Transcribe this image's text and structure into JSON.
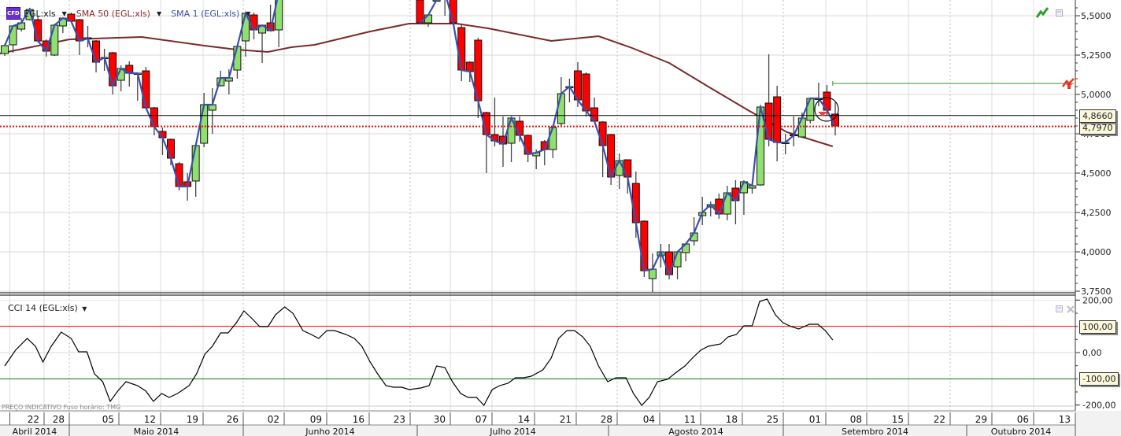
{
  "legend": {
    "symbol_badge": "CFD",
    "symbol": "EGL:xls",
    "sma50": "SMA 50 (EGL:xls)",
    "sma1": "SMA 1 (EGL:xls)"
  },
  "cci_legend": "CCI 14 (EGL:xls)",
  "footnote": "PREÇO INDICATIVO   Fuso horário: TMG",
  "colors": {
    "up": "#90e070",
    "down": "#ff0000",
    "sma50": "#7b2a2a",
    "sma1": "#3b4fae",
    "cci": "#000000",
    "cci_upper": "#ff0000",
    "cci_lower": "#1a6a1a",
    "last_price": "#000000",
    "bid": "#ff0000",
    "alert": "#2a9a2a"
  },
  "price_axis": {
    "ticks": [
      "5,5000",
      "5,2500",
      "5,0000",
      "4,7500",
      "4,5000",
      "4,2500",
      "4,0000",
      "3,7500"
    ],
    "tick_values": [
      5.5,
      5.25,
      5.0,
      4.75,
      4.5,
      4.25,
      4.0,
      3.75
    ]
  },
  "price_tags": {
    "last": "4,8660",
    "last_value": 4.866,
    "bid": "4,7970",
    "bid_value": 4.797
  },
  "alert_level": 5.07,
  "cci_axis": {
    "ticks": [
      "200,00",
      "0,00",
      "-200,00"
    ],
    "tick_values": [
      200,
      0,
      -200
    ],
    "upper": "100,00",
    "upper_value": 100,
    "lower": "-100,00",
    "lower_value": -100
  },
  "x_axis": {
    "days": [
      "22",
      "28",
      "05",
      "12",
      "19",
      "26",
      "02",
      "09",
      "16",
      "23",
      "30",
      "07",
      "14",
      "21",
      "28",
      "04",
      "11",
      "18",
      "25",
      "01",
      "08",
      "15",
      "22",
      "29",
      "06",
      "13"
    ],
    "months": [
      "Abril 2014",
      "Maio 2014",
      "Junho 2014",
      "Julho 2014",
      "Agosto 2014",
      "Setembro 2014",
      "Outubro 2014"
    ]
  },
  "chart_data": {
    "type": "candlestick",
    "ohlc_index_start": 0,
    "ohlc": [
      [
        5.26,
        5.32,
        5.245,
        5.31
      ],
      [
        5.315,
        5.44,
        5.265,
        5.435
      ],
      [
        5.415,
        5.485,
        5.4,
        5.455
      ],
      [
        5.475,
        5.55,
        5.47,
        5.54
      ],
      [
        5.475,
        5.5,
        5.33,
        5.34
      ],
      [
        5.34,
        5.35,
        5.24,
        5.275
      ],
      [
        5.25,
        5.45,
        5.245,
        5.44
      ],
      [
        5.435,
        5.49,
        5.39,
        5.485
      ],
      [
        5.51,
        5.52,
        5.46,
        5.465
      ],
      [
        5.475,
        5.48,
        5.25,
        5.34
      ],
      [
        5.36,
        5.435,
        5.3,
        5.355
      ],
      [
        5.34,
        5.345,
        5.14,
        5.205
      ],
      [
        5.235,
        5.29,
        5.15,
        5.235
      ],
      [
        5.265,
        5.27,
        5.0,
        5.055
      ],
      [
        5.09,
        5.185,
        5.02,
        5.165
      ],
      [
        5.185,
        5.21,
        5.05,
        5.135
      ],
      [
        5.135,
        5.14,
        4.96,
        5.135
      ],
      [
        5.15,
        5.175,
        4.91,
        4.915
      ],
      [
        4.915,
        4.92,
        4.74,
        4.795
      ],
      [
        4.765,
        4.79,
        4.615,
        4.725
      ],
      [
        4.715,
        4.72,
        4.55,
        4.595
      ],
      [
        4.56,
        4.57,
        4.39,
        4.415
      ],
      [
        4.445,
        4.5,
        4.325,
        4.415
      ],
      [
        4.45,
        4.68,
        4.35,
        4.675
      ],
      [
        4.69,
        5.01,
        4.665,
        4.935
      ],
      [
        4.9,
        5.04,
        4.75,
        4.935
      ],
      [
        5.055,
        5.15,
        5.05,
        5.105
      ],
      [
        5.085,
        5.16,
        5.0,
        5.105
      ],
      [
        5.155,
        5.305,
        5.1,
        5.305
      ],
      [
        5.34,
        5.515,
        5.24,
        5.515
      ],
      [
        5.505,
        5.52,
        5.35,
        5.41
      ],
      [
        5.39,
        5.44,
        5.2,
        5.44
      ],
      [
        5.455,
        5.57,
        5.4,
        5.405
      ],
      [
        5.41,
        5.7,
        5.3,
        5.65
      ],
      null,
      null,
      null,
      null,
      null,
      null,
      null,
      null,
      null,
      null,
      null,
      null,
      null,
      null,
      null,
      null,
      [
        5.6,
        5.65,
        5.455,
        5.455
      ],
      [
        5.455,
        5.505,
        5.43,
        5.505
      ],
      [
        5.6,
        5.65,
        5.6,
        5.6
      ],
      [
        5.62,
        5.7,
        5.5,
        5.65
      ],
      [
        5.65,
        5.7,
        5.44,
        5.455
      ],
      [
        5.425,
        5.44,
        5.085,
        5.155
      ],
      [
        5.205,
        5.21,
        5.08,
        5.145
      ],
      [
        5.345,
        5.36,
        4.85,
        4.96
      ],
      [
        4.885,
        4.89,
        4.5,
        4.745
      ],
      [
        4.745,
        4.98,
        4.67,
        4.705
      ],
      [
        4.735,
        4.86,
        4.54,
        4.685
      ],
      [
        4.69,
        4.86,
        4.57,
        4.85
      ],
      [
        4.83,
        4.86,
        4.7,
        4.74
      ],
      [
        4.74,
        4.745,
        4.57,
        4.62
      ],
      [
        4.61,
        4.65,
        4.525,
        4.63
      ],
      [
        4.7,
        4.71,
        4.55,
        4.65
      ],
      [
        4.65,
        4.8,
        4.595,
        4.79
      ],
      [
        4.815,
        5.11,
        4.8,
        5.005
      ],
      [
        5.045,
        5.1,
        4.95,
        5.05
      ],
      [
        5.15,
        5.205,
        4.92,
        4.965
      ],
      [
        5.13,
        5.14,
        4.86,
        4.895
      ],
      [
        4.915,
        4.98,
        4.82,
        4.83
      ],
      [
        4.825,
        4.83,
        4.475,
        4.675
      ],
      [
        4.745,
        4.75,
        4.425,
        4.475
      ],
      [
        4.485,
        4.625,
        4.4,
        4.58
      ],
      [
        4.585,
        4.585,
        4.37,
        4.475
      ],
      [
        4.435,
        4.51,
        4.09,
        4.185
      ],
      [
        4.195,
        4.2,
        3.84,
        3.88
      ],
      [
        3.83,
        3.99,
        3.74,
        3.89
      ],
      [
        3.975,
        4.05,
        3.9,
        4.0
      ],
      [
        4.0,
        4.05,
        3.825,
        3.855
      ],
      [
        3.905,
        4.0,
        3.825,
        4.0
      ],
      [
        3.995,
        4.05,
        3.94,
        4.05
      ],
      [
        4.07,
        4.22,
        4.04,
        4.12
      ],
      [
        4.23,
        4.35,
        4.17,
        4.25
      ],
      [
        4.285,
        4.32,
        4.225,
        4.3
      ],
      [
        4.335,
        4.37,
        4.21,
        4.24
      ],
      [
        4.24,
        4.42,
        4.2,
        4.375
      ],
      [
        4.405,
        4.455,
        4.175,
        4.325
      ],
      [
        4.375,
        4.455,
        4.235,
        4.445
      ],
      [
        4.405,
        4.43,
        4.37,
        4.42
      ],
      [
        4.425,
        4.935,
        4.42,
        4.92
      ],
      [
        4.945,
        5.255,
        4.67,
        4.715
      ],
      [
        4.985,
        5.055,
        4.575,
        4.695
      ],
      [
        4.695,
        4.75,
        4.62,
        4.695
      ],
      [
        4.745,
        4.86,
        4.67,
        4.74
      ],
      [
        4.73,
        4.885,
        4.725,
        4.85
      ],
      [
        4.835,
        4.98,
        4.815,
        4.975
      ],
      [
        4.975,
        5.075,
        4.925,
        4.975
      ],
      [
        5.015,
        5.06,
        4.865,
        4.9
      ],
      [
        4.875,
        4.95,
        4.74,
        4.8
      ]
    ],
    "sma50": [
      [
        -0.6,
        5.26
      ],
      [
        7.8,
        5.35
      ],
      [
        16.5,
        5.365
      ],
      [
        24,
        5.31
      ],
      [
        27.9,
        5.285
      ],
      [
        31.7,
        5.27
      ],
      [
        34.5,
        5.3
      ],
      [
        37.3,
        5.315
      ],
      [
        44,
        5.4
      ],
      [
        48.7,
        5.45
      ],
      [
        54.4,
        5.45
      ],
      [
        58.2,
        5.42
      ],
      [
        65.8,
        5.34
      ],
      [
        71.5,
        5.37
      ],
      [
        75.3,
        5.3
      ],
      [
        80,
        5.2
      ],
      [
        84.7,
        5.05
      ],
      [
        89.5,
        4.9
      ],
      [
        94.2,
        4.76
      ],
      [
        99.7,
        4.67
      ]
    ],
    "cci": [
      [
        0,
        -51
      ],
      [
        1.3,
        9
      ],
      [
        2.7,
        54
      ],
      [
        3.7,
        24
      ],
      [
        4.6,
        -36
      ],
      [
        5.6,
        24
      ],
      [
        6.8,
        78
      ],
      [
        8,
        54
      ],
      [
        8.9,
        3
      ],
      [
        9.9,
        3
      ],
      [
        10.8,
        -81
      ],
      [
        11.8,
        -111
      ],
      [
        12.7,
        -186
      ],
      [
        13.6,
        -147
      ],
      [
        14.6,
        -111
      ],
      [
        16,
        -126
      ],
      [
        17,
        -147
      ],
      [
        17.9,
        -186
      ],
      [
        18.9,
        -156
      ],
      [
        19.8,
        -171
      ],
      [
        20.8,
        -156
      ],
      [
        22.2,
        -126
      ],
      [
        23.1,
        -81
      ],
      [
        24.1,
        -6
      ],
      [
        25,
        24
      ],
      [
        26,
        75
      ],
      [
        26.9,
        75
      ],
      [
        27.9,
        114
      ],
      [
        28.8,
        159
      ],
      [
        29.8,
        129
      ],
      [
        30.7,
        99
      ],
      [
        31.7,
        99
      ],
      [
        32.6,
        144
      ],
      [
        33.7,
        174
      ],
      [
        34.7,
        150
      ],
      [
        35.9,
        84
      ],
      [
        36.9,
        69
      ],
      [
        37.8,
        54
      ],
      [
        38.8,
        84
      ],
      [
        39.7,
        84
      ],
      [
        41.1,
        69
      ],
      [
        42.1,
        54
      ],
      [
        43,
        24
      ],
      [
        44,
        -36
      ],
      [
        44.9,
        -81
      ],
      [
        45.9,
        -126
      ],
      [
        46.8,
        -132
      ],
      [
        47.8,
        -132
      ],
      [
        48.7,
        -141
      ],
      [
        50.1,
        -135
      ],
      [
        51.1,
        -126
      ],
      [
        52,
        -51
      ],
      [
        53,
        -57
      ],
      [
        53.9,
        -111
      ],
      [
        54.9,
        -156
      ],
      [
        55.8,
        -171
      ],
      [
        56.8,
        -171
      ],
      [
        57.7,
        -201
      ],
      [
        58.7,
        -141
      ],
      [
        59.6,
        -126
      ],
      [
        60.6,
        -117
      ],
      [
        61.5,
        -96
      ],
      [
        62.5,
        -96
      ],
      [
        63.4,
        -90
      ],
      [
        64.8,
        -66
      ],
      [
        65.8,
        -21
      ],
      [
        66.7,
        54
      ],
      [
        67.7,
        84
      ],
      [
        68.6,
        84
      ],
      [
        69.6,
        60
      ],
      [
        70.5,
        24
      ],
      [
        71.5,
        -51
      ],
      [
        72.6,
        -111
      ],
      [
        73.6,
        -96
      ],
      [
        74.8,
        -96
      ],
      [
        75.7,
        -156
      ],
      [
        76.7,
        -201
      ],
      [
        77.6,
        -171
      ],
      [
        78.6,
        -111
      ],
      [
        79.8,
        -102
      ],
      [
        81,
        -72
      ],
      [
        81.9,
        -51
      ],
      [
        82.8,
        -21
      ],
      [
        83.8,
        9
      ],
      [
        84.7,
        24
      ],
      [
        86.2,
        33
      ],
      [
        87.1,
        60
      ],
      [
        88.1,
        69
      ],
      [
        89,
        102
      ],
      [
        90,
        102
      ],
      [
        90.9,
        195
      ],
      [
        91.8,
        204
      ],
      [
        92.8,
        144
      ],
      [
        93.7,
        114
      ],
      [
        94.7,
        99
      ],
      [
        95.6,
        90
      ],
      [
        96.9,
        108
      ],
      [
        97.9,
        108
      ],
      [
        98.8,
        84
      ],
      [
        99.7,
        48
      ]
    ],
    "ylim": [
      3.75,
      5.5
    ],
    "cci_ylim": [
      -200,
      200
    ]
  }
}
